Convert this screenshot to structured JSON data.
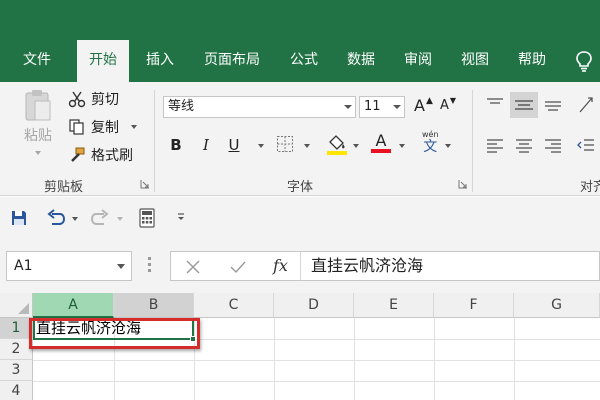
{
  "menu": {
    "tabs": [
      {
        "label": "文件"
      },
      {
        "label": "开始",
        "active": true
      },
      {
        "label": "插入"
      },
      {
        "label": "页面布局"
      },
      {
        "label": "公式"
      },
      {
        "label": "数据"
      },
      {
        "label": "审阅"
      },
      {
        "label": "视图"
      },
      {
        "label": "帮助"
      }
    ],
    "tell_me_icon": "lightbulb-icon"
  },
  "ribbon": {
    "clipboard": {
      "paste_label": "粘贴",
      "cut_label": "剪切",
      "copy_label": "复制",
      "format_painter_label": "格式刷",
      "group_label": "剪贴板"
    },
    "font": {
      "font_name": "等线",
      "font_size": "11",
      "bold_label": "B",
      "italic_label": "I",
      "underline_label": "U",
      "grow_label": "A",
      "shrink_label": "A",
      "font_color_label": "A",
      "phonetic_label": "文",
      "phonetic_top": "wén",
      "group_label": "字体",
      "fill_color": "#ffe500",
      "font_color": "#e81123"
    },
    "alignment": {
      "group_label_partial": "对齐"
    }
  },
  "formula_bar": {
    "name_box": "A1",
    "cancel_icon": "close-icon",
    "enter_icon": "check-icon",
    "fx_label": "fx",
    "formula": "直挂云帆济沧海"
  },
  "grid": {
    "columns": [
      "A",
      "B",
      "C",
      "D",
      "E",
      "F",
      "G"
    ],
    "rows": [
      "1",
      "2",
      "3",
      "4"
    ],
    "cell_a1": "直挂云帆济沧海",
    "selected_cell": "A1"
  },
  "colors": {
    "brand": "#217346",
    "annotation": "#d42b2b"
  }
}
